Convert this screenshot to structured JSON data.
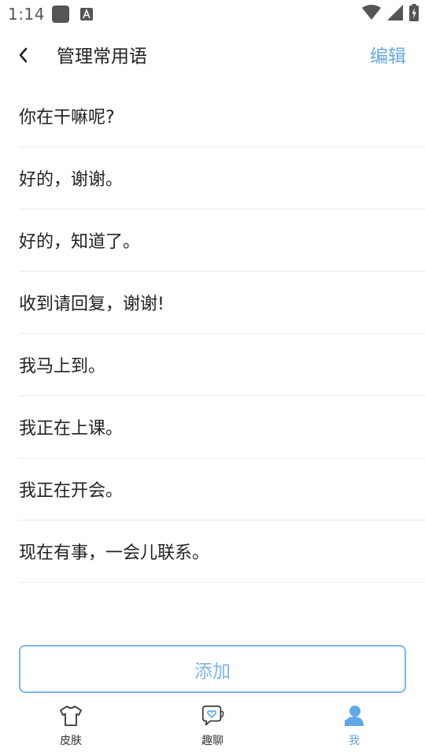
{
  "status_bar": {
    "time": "1:14",
    "icons": [
      "app-icon",
      "a-notification-icon",
      "wifi-icon",
      "signal-icon",
      "battery-icon"
    ]
  },
  "header": {
    "back_icon": "chevron-left-icon",
    "title": "管理常用语",
    "edit_label": "编辑"
  },
  "phrases": [
    "你在干嘛呢?",
    "好的，谢谢。",
    "好的，知道了。",
    "收到请回复，谢谢!",
    "我马上到。",
    "我正在上课。",
    "我正在开会。",
    "现在有事，一会儿联系。"
  ],
  "add_button": {
    "label": "添加"
  },
  "tab_bar": {
    "tabs": [
      {
        "label": "皮肤",
        "icon": "tshirt-icon",
        "active": false
      },
      {
        "label": "趣聊",
        "icon": "chat-heart-icon",
        "active": false
      },
      {
        "label": "我",
        "icon": "person-icon",
        "active": true
      }
    ]
  },
  "colors": {
    "accent": "#64a8e8",
    "add_border": "#7cb5ec",
    "divider": "#ebebeb",
    "text": "#222222"
  }
}
